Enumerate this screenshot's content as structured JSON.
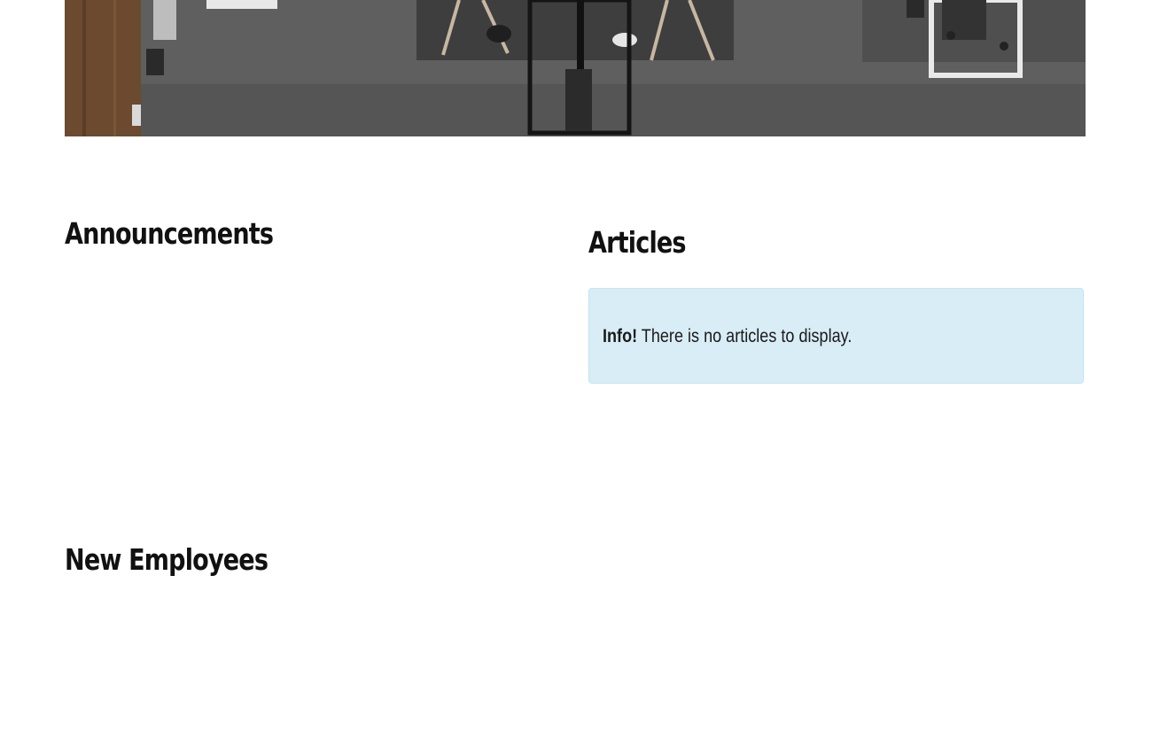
{
  "sections": {
    "announcements": {
      "title": "Announcements"
    },
    "articles": {
      "title": "Articles",
      "alert": {
        "label": "Info!",
        "message": " There is no articles to display.",
        "background": "#d9edf7",
        "border": "#bce8f1"
      }
    },
    "new_employees": {
      "title": "New Employees"
    }
  }
}
